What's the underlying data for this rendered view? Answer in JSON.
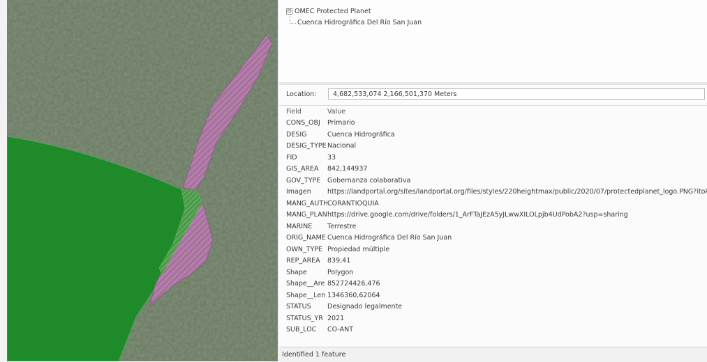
{
  "tree": {
    "layer_name": "OMEC Protected Planet",
    "feature_name": "Cuenca Hidrográfica Del Río San Juan",
    "expand_symbol": "⊟"
  },
  "location": {
    "label": "Location:",
    "value": "4,682,533,074  2,166,501,370 Meters"
  },
  "table": {
    "header_field": "Field",
    "header_value": "Value",
    "rows": [
      {
        "field": "CONS_OBJ",
        "value": "Primario"
      },
      {
        "field": "DESIG",
        "value": "Cuenca Hidrográfica"
      },
      {
        "field": "DESIG_TYPE",
        "value": "Nacional"
      },
      {
        "field": "FID",
        "value": "33"
      },
      {
        "field": "GIS_AREA",
        "value": "842,144937"
      },
      {
        "field": "GOV_TYPE",
        "value": "Gobernanza colaborativa"
      },
      {
        "field": "Imagen",
        "value": "https://landportal.org/sites/landportal.org/files/styles/220heightmax/public/2020/07/protectedplanet_logo.PNG?itok"
      },
      {
        "field": "MANG_AUTH",
        "value": "CORANTIOQUIA"
      },
      {
        "field": "MANG_PLAN",
        "value": "https://drive.google.com/drive/folders/1_ArFTaJEzA5yJLwwXILOLpjb4UdPobA2?usp=sharing"
      },
      {
        "field": "MARINE",
        "value": "Terrestre"
      },
      {
        "field": "ORIG_NAME",
        "value": "Cuenca Hidrográfica Del Río San Juan"
      },
      {
        "field": "OWN_TYPE",
        "value": "Propiedad múltiple"
      },
      {
        "field": "REP_AREA",
        "value": "839,41"
      },
      {
        "field": "Shape",
        "value": "Polygon"
      },
      {
        "field": "Shape__Are",
        "value": "852724426,476"
      },
      {
        "field": "Shape__Len",
        "value": "1346360,62064"
      },
      {
        "field": "STATUS",
        "value": "Designado legalmente"
      },
      {
        "field": "STATUS_YR",
        "value": "2021"
      },
      {
        "field": "SUB_LOC",
        "value": "CO-ANT"
      }
    ]
  },
  "status_bar": {
    "text": "Identified 1 feature"
  },
  "colors": {
    "green_polygon": "#1f8a2a",
    "purple_hatch": "#a8739e",
    "imagery_base": "#3f4f3a"
  }
}
